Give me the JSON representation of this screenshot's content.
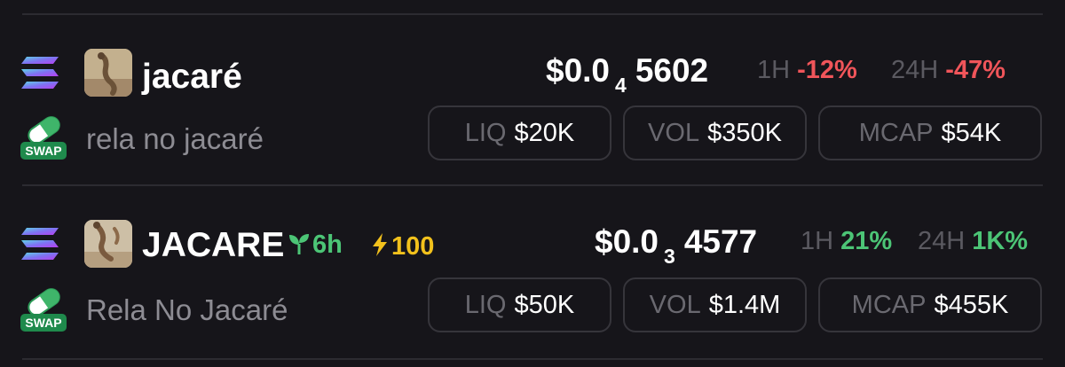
{
  "tokens": [
    {
      "name": "jacaré",
      "description": "rela no jacaré",
      "price": {
        "prefix": "$0.0",
        "zeros": "4",
        "digits": "5602"
      },
      "change_1h": {
        "label": "1H",
        "value": "-12%",
        "direction": "down"
      },
      "change_24h": {
        "label": "24H",
        "value": "-47%",
        "direction": "down"
      },
      "stats": [
        {
          "label": "LIQ",
          "value": "$20K"
        },
        {
          "label": "VOL",
          "value": "$350K"
        },
        {
          "label": "MCAP",
          "value": "$54K"
        }
      ],
      "chain_icon": "solana-icon",
      "dex_icon": "swap-icon"
    },
    {
      "name": "JACARE",
      "description": "Rela No Jacaré",
      "age": "6h",
      "boost": "100",
      "price": {
        "prefix": "$0.0",
        "zeros": "3",
        "digits": "4577"
      },
      "change_1h": {
        "label": "1H",
        "value": "21%",
        "direction": "up"
      },
      "change_24h": {
        "label": "24H",
        "value": "1K%",
        "direction": "up"
      },
      "stats": [
        {
          "label": "LIQ",
          "value": "$50K"
        },
        {
          "label": "VOL",
          "value": "$1.4M"
        },
        {
          "label": "MCAP",
          "value": "$455K"
        }
      ],
      "chain_icon": "solana-icon",
      "dex_icon": "swap-icon"
    }
  ],
  "swap_label": "SWAP",
  "colors": {
    "background": "#16151a",
    "negative": "#f0555a",
    "positive": "#4cc576",
    "boost": "#f2c11c",
    "muted": "#8d8c93"
  }
}
